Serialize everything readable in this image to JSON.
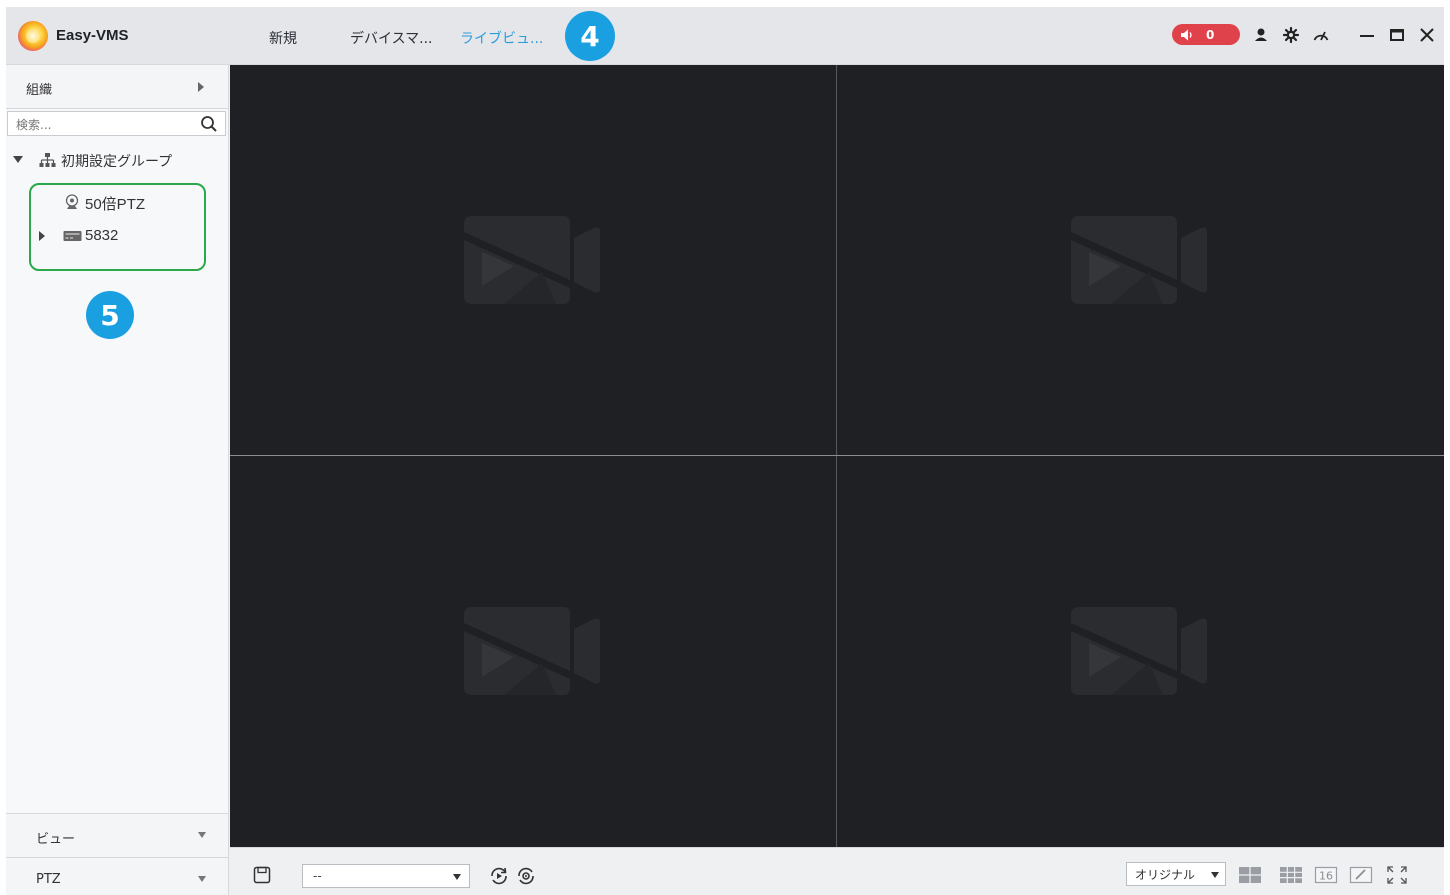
{
  "app": {
    "title": "Easy-VMS"
  },
  "tabs": [
    {
      "label": "新規"
    },
    {
      "label": "デバイスマ..."
    },
    {
      "label": "ライブビュ..."
    }
  ],
  "annotations": {
    "step_4": "4",
    "step_5": "5"
  },
  "alarm": {
    "count": "0"
  },
  "sidebar": {
    "org_label": "組織",
    "search_placeholder": "検索...",
    "tree": {
      "root_label": "初期設定グループ",
      "items": [
        {
          "label": "50倍PTZ",
          "icon": "ptz-camera-icon"
        },
        {
          "label": "5832",
          "icon": "nvr-device-icon"
        }
      ]
    },
    "view_label": "ビュー",
    "ptz_label": "PTZ"
  },
  "bottombar": {
    "view_select_value": "--",
    "ratio_value": "オリジナル",
    "layout_16_label": "16"
  },
  "colors": {
    "accent": "#2d9cdb",
    "badge": "#1a9fe0",
    "alarm": "#e0424b",
    "highlight": "#2aa84a",
    "video_bg": "#1f2023"
  }
}
